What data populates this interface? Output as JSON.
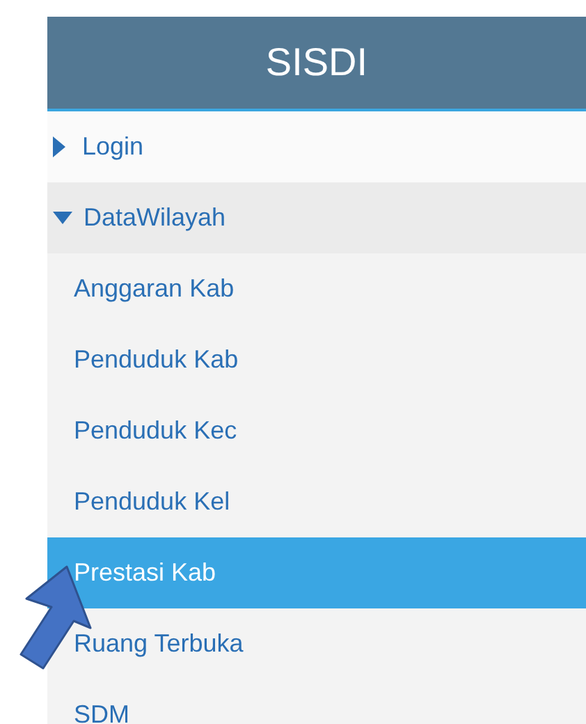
{
  "sidebar": {
    "title": "SISDI",
    "items": [
      {
        "label": "Login",
        "expanded": false
      },
      {
        "label": "DataWilayah",
        "expanded": true,
        "children": [
          {
            "label": "Anggaran Kab",
            "selected": false
          },
          {
            "label": "Penduduk Kab",
            "selected": false
          },
          {
            "label": "Penduduk Kec",
            "selected": false
          },
          {
            "label": "Penduduk Kel",
            "selected": false
          },
          {
            "label": "Prestasi Kab",
            "selected": true
          },
          {
            "label": "Ruang Terbuka",
            "selected": false
          },
          {
            "label": "SDM",
            "selected": false
          }
        ]
      }
    ]
  }
}
